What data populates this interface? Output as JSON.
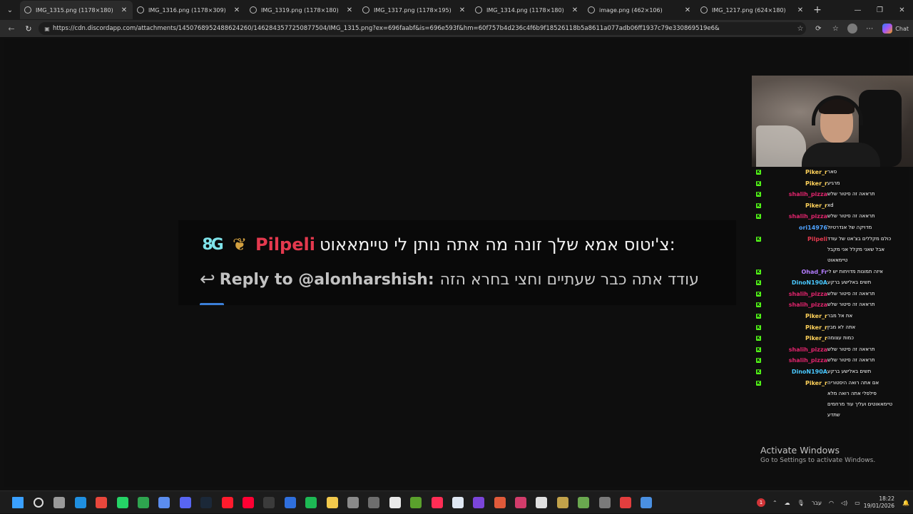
{
  "browser": {
    "tabs": [
      {
        "label": "IMG_1315.png (1178×180)",
        "active": true
      },
      {
        "label": "IMG_1316.png (1178×309)",
        "active": false
      },
      {
        "label": "IMG_1319.png (1178×180)",
        "active": false
      },
      {
        "label": "IMG_1317.png (1178×195)",
        "active": false
      },
      {
        "label": "IMG_1314.png (1178×180)",
        "active": false
      },
      {
        "label": "image.png (462×106)",
        "active": false
      },
      {
        "label": "IMG_1217.png (624×180)",
        "active": false
      }
    ],
    "url": "https://cdn.discordapp.com/attachments/1450768952488624260/1462843577250877504/IMG_1315.png?ex=696faabf&is=696e593f&hm=60f757b4d236c4f6b9f18526118b5a8611a077adb06ff1937c79e330869519e6&",
    "chat_button_label": "Chat"
  },
  "banner": {
    "badge_text": "8G",
    "username": "Pilpeli",
    "message": ":צ'יטוס אמא שלך זונה מה אתה נותן לי טיימאאוט",
    "reply_to": "Reply to @alonharshish:",
    "reply_text": "עודד אתה כבר שעתיים וחצי בחרא הזה"
  },
  "chat": {
    "rows": [
      {
        "user": "Piker_r",
        "color": "#ffd25a",
        "message": "סאר",
        "kick": true
      },
      {
        "user": "Piker_r",
        "color": "#ffd25a",
        "message": "מרגיע",
        "kick": true
      },
      {
        "user": "shalih_pizza",
        "color": "#e0246c",
        "message": "תראאה זה סיטור שלש",
        "kick": true
      },
      {
        "user": "Piker_r",
        "color": "#ffd25a",
        "message": "xd",
        "kick": true
      },
      {
        "user": "shalih_pizza",
        "color": "#e0246c",
        "message": "תראאה זה סיטור שלש",
        "kick": true
      },
      {
        "user": "ori14976",
        "color": "#4fa3ff",
        "message": "מדויקה של אנדרטיול",
        "kick": false
      },
      {
        "user": "Pilpeli",
        "color": "#e4394e",
        "message": "כולם מקללים בצ'אט של עודד אבל שאני מקלל אני מקבל טיימאאוט",
        "kick": true,
        "tall": true
      },
      {
        "user": "Ohad_Fr",
        "color": "#b37bff",
        "message": "איזה תמונות מדויחות יש לי",
        "kick": true
      },
      {
        "user": "DinoN190A",
        "color": "#49c8ff",
        "message": "תשים באלישע ברקע",
        "kick": true
      },
      {
        "user": "shalih_pizza",
        "color": "#e0246c",
        "message": "תראאה זה סיטור שלש",
        "kick": true
      },
      {
        "user": "shalih_pizza",
        "color": "#e0246c",
        "message": "תראאה זה סיטור שלש",
        "kick": true
      },
      {
        "user": "Piker_r",
        "color": "#ffd25a",
        "message": "את אל מבר",
        "kick": true
      },
      {
        "user": "Piker_r",
        "color": "#ffd25a",
        "message": "אתה לא מבין",
        "kick": true
      },
      {
        "user": "Piker_r",
        "color": "#ffd25a",
        "message": "כמות עצומה",
        "kick": true
      },
      {
        "user": "shalih_pizza",
        "color": "#e0246c",
        "message": "תראאה זה סיטור שלש",
        "kick": true
      },
      {
        "user": "shalih_pizza",
        "color": "#e0246c",
        "message": "תראאה זה סיטור שלש",
        "kick": true
      },
      {
        "user": "DinoN190A",
        "color": "#49c8ff",
        "message": "תשים באלישע ברקע",
        "kick": true
      },
      {
        "user": "Piker_r",
        "color": "#ffd25a",
        "message": "אם אתה רואה היסטוריה פילפלי אתה רואה מלא טיימאאוטים ועליך עוד מרחמים שתדע",
        "kick": true,
        "tall": true
      }
    ]
  },
  "watermark": {
    "title": "Activate Windows",
    "subtitle": "Go to Settings to activate Windows."
  },
  "taskbar": {
    "icons": [
      "windows-start-icon",
      "search-icon",
      "task-view-icon",
      "edge-icon",
      "chrome-icon",
      "whatsapp-icon",
      "xbox-icon",
      "copilot-icon",
      "discord-icon",
      "steam-icon",
      "opera-icon",
      "youtube-icon",
      "obs-icon",
      "store-icon",
      "spotify-icon",
      "file-explorer-icon",
      "app-icon",
      "app-icon",
      "capcut-icon",
      "minecraft-icon",
      "heart-app-icon",
      "notepad-icon",
      "clipchamp-icon",
      "app-icon",
      "app-icon",
      "epic-games-icon",
      "app-icon",
      "minecraft-launcher-icon",
      "app-icon",
      "app-icon",
      "app-icon"
    ],
    "language": "עבר",
    "time": "18:22",
    "date": "19/01/2026",
    "notification_count": "1"
  }
}
